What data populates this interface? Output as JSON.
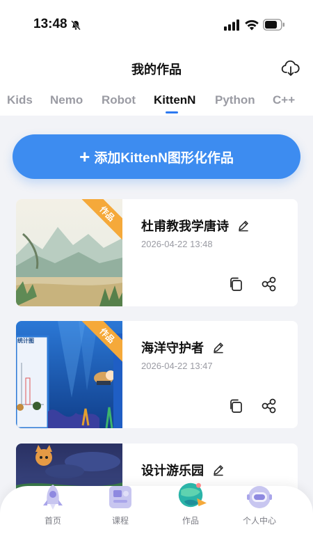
{
  "status_bar": {
    "time": "13:48"
  },
  "header": {
    "title": "我的作品"
  },
  "tabs": [
    {
      "label": "Kids"
    },
    {
      "label": "Nemo"
    },
    {
      "label": "Robot"
    },
    {
      "label": "KittenN",
      "active": true
    },
    {
      "label": "Python"
    },
    {
      "label": "C++"
    }
  ],
  "add_button": {
    "label": "添加KittenN图形化作品"
  },
  "works": [
    {
      "badge": "作品",
      "name": "杜甫教我学唐诗",
      "date": "2026-04-22 13:48"
    },
    {
      "badge": "作品",
      "name": "海洋守护者",
      "date": "2026-04-22 13:47"
    },
    {
      "badge": "",
      "name": "设计游乐园",
      "date": ""
    }
  ],
  "thumb2_label": "统计图",
  "bottom_nav": [
    {
      "label": "首页",
      "icon": "rocket-icon"
    },
    {
      "label": "课程",
      "icon": "course-book-icon"
    },
    {
      "label": "作品",
      "icon": "planet-icon",
      "active": true
    },
    {
      "label": "个人中心",
      "icon": "astronaut-icon"
    }
  ],
  "colors": {
    "accent": "#3d8cf0",
    "badge": "#f5a93a",
    "background": "#f2f3f7"
  }
}
